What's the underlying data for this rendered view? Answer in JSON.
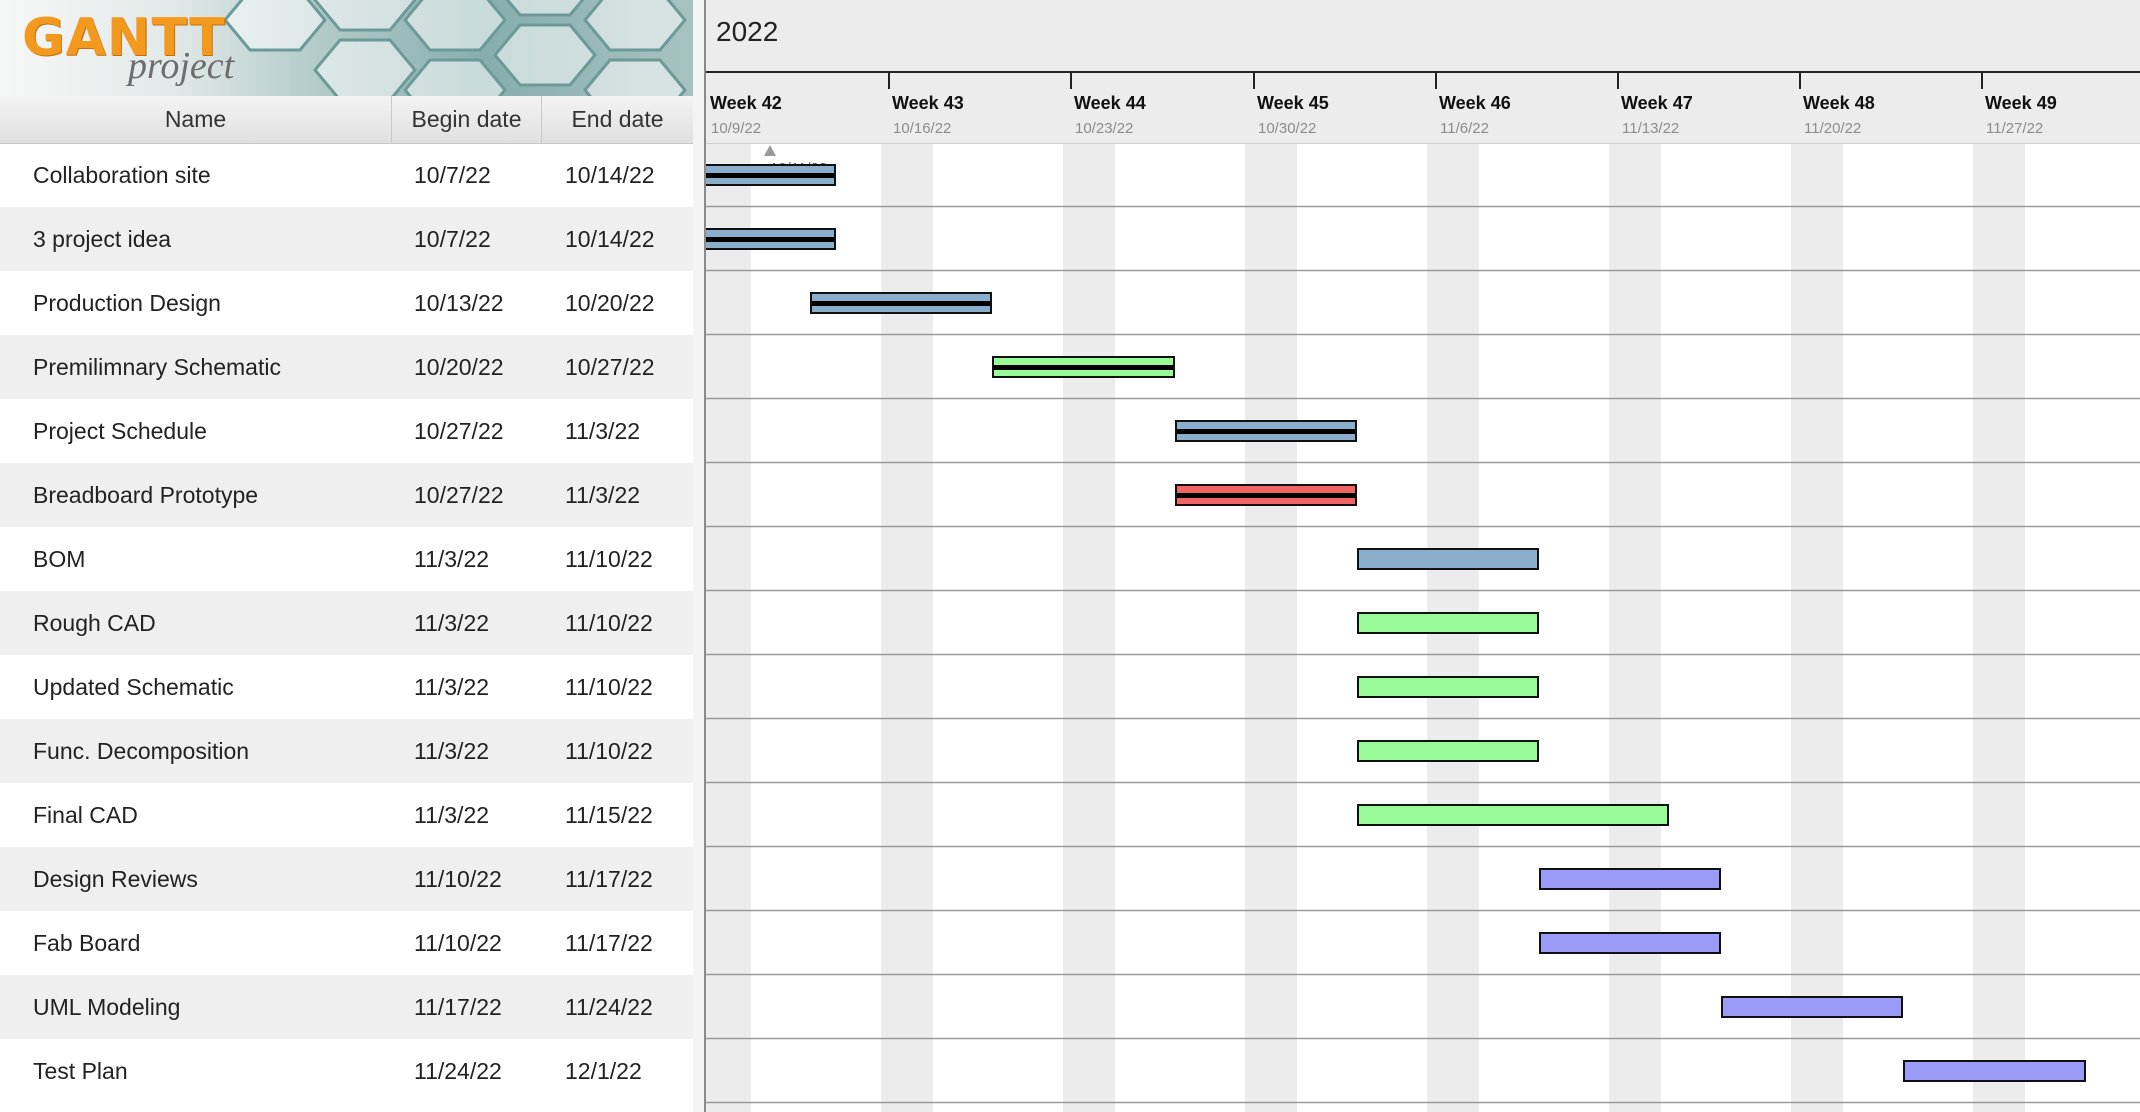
{
  "logo": {
    "gantt": "GANTT",
    "project": "project"
  },
  "table": {
    "headers": {
      "name": "Name",
      "begin": "Begin date",
      "end": "End date"
    },
    "rows": [
      {
        "name": "Collaboration site",
        "begin": "10/7/22",
        "end": "10/14/22"
      },
      {
        "name": "3 project idea",
        "begin": "10/7/22",
        "end": "10/14/22"
      },
      {
        "name": "Production Design",
        "begin": "10/13/22",
        "end": "10/20/22"
      },
      {
        "name": "Premilimnary Schematic",
        "begin": "10/20/22",
        "end": "10/27/22"
      },
      {
        "name": "Project Schedule",
        "begin": "10/27/22",
        "end": "11/3/22"
      },
      {
        "name": "Breadboard Prototype",
        "begin": "10/27/22",
        "end": "11/3/22"
      },
      {
        "name": "BOM",
        "begin": "11/3/22",
        "end": "11/10/22"
      },
      {
        "name": "Rough CAD",
        "begin": "11/3/22",
        "end": "11/10/22"
      },
      {
        "name": "Updated Schematic",
        "begin": "11/3/22",
        "end": "11/10/22"
      },
      {
        "name": "Func. Decomposition",
        "begin": "11/3/22",
        "end": "11/10/22"
      },
      {
        "name": "Final CAD",
        "begin": "11/3/22",
        "end": "11/15/22"
      },
      {
        "name": "Design Reviews",
        "begin": "11/10/22",
        "end": "11/17/22"
      },
      {
        "name": "Fab Board",
        "begin": "11/10/22",
        "end": "11/17/22"
      },
      {
        "name": "UML Modeling",
        "begin": "11/17/22",
        "end": "11/24/22"
      },
      {
        "name": "Test Plan",
        "begin": "11/24/22",
        "end": "12/1/22"
      }
    ]
  },
  "timeline": {
    "year": "2022",
    "today_label": "10/11/22",
    "weeks": [
      {
        "label": "Week 42",
        "date": "10/9/22"
      },
      {
        "label": "Week 43",
        "date": "10/16/22"
      },
      {
        "label": "Week 44",
        "date": "10/23/22"
      },
      {
        "label": "Week 45",
        "date": "10/30/22"
      },
      {
        "label": "Week 46",
        "date": "11/6/22"
      },
      {
        "label": "Week 47",
        "date": "11/13/22"
      },
      {
        "label": "Week 48",
        "date": "11/20/22"
      },
      {
        "label": "Week 49",
        "date": "11/27/22"
      }
    ]
  },
  "tasks": [
    {
      "start": "2022-10-07",
      "end": "2022-10-14",
      "color": "#8aaecc",
      "progress_line": true
    },
    {
      "start": "2022-10-07",
      "end": "2022-10-14",
      "color": "#8aaecc",
      "progress_line": true
    },
    {
      "start": "2022-10-13",
      "end": "2022-10-20",
      "color": "#8aaecc",
      "progress_line": true
    },
    {
      "start": "2022-10-20",
      "end": "2022-10-27",
      "color": "#98fb98",
      "progress_line": true
    },
    {
      "start": "2022-10-27",
      "end": "2022-11-03",
      "color": "#8aaecc",
      "progress_line": true
    },
    {
      "start": "2022-10-27",
      "end": "2022-11-03",
      "color": "#f06464",
      "progress_line": true
    },
    {
      "start": "2022-11-03",
      "end": "2022-11-10",
      "color": "#8aaecc",
      "progress_line": false
    },
    {
      "start": "2022-11-03",
      "end": "2022-11-10",
      "color": "#98fb98",
      "progress_line": false
    },
    {
      "start": "2022-11-03",
      "end": "2022-11-10",
      "color": "#98fb98",
      "progress_line": false
    },
    {
      "start": "2022-11-03",
      "end": "2022-11-10",
      "color": "#98fb98",
      "progress_line": false
    },
    {
      "start": "2022-11-03",
      "end": "2022-11-15",
      "color": "#98fb98",
      "progress_line": false
    },
    {
      "start": "2022-11-10",
      "end": "2022-11-17",
      "color": "#9b9bf8",
      "progress_line": false
    },
    {
      "start": "2022-11-10",
      "end": "2022-11-17",
      "color": "#9b9bf8",
      "progress_line": false
    },
    {
      "start": "2022-11-17",
      "end": "2022-11-24",
      "color": "#9b9bf8",
      "progress_line": false
    },
    {
      "start": "2022-11-24",
      "end": "2022-12-01",
      "color": "#9b9bf8",
      "progress_line": false
    }
  ]
}
